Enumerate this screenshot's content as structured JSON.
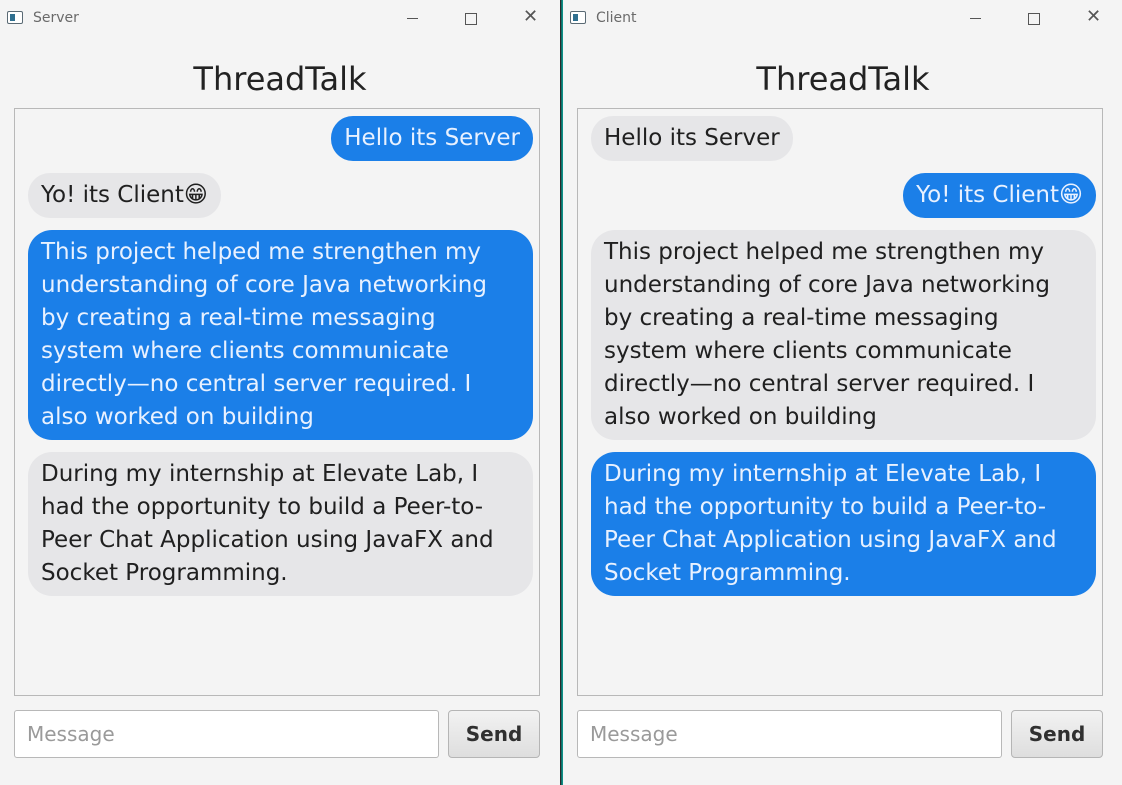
{
  "server": {
    "window_title": "Server",
    "app_heading": "ThreadTalk",
    "messages": [
      {
        "side": "right",
        "type": "sent",
        "text": "Hello its Server"
      },
      {
        "side": "left",
        "type": "recv",
        "text": "Yo! its Client😁"
      },
      {
        "side": "left",
        "type": "sent",
        "text": "This project helped me strengthen my understanding of core Java networking by creating a real-time messaging system where clients communicate directly—no central server required. I also worked on building"
      },
      {
        "side": "left",
        "type": "recv",
        "text": "During my internship at Elevate Lab, I had the opportunity to build a Peer-to-Peer Chat Application using JavaFX and Socket Programming."
      }
    ],
    "input_placeholder": "Message",
    "send_label": "Send"
  },
  "client": {
    "window_title": "Client",
    "app_heading": "ThreadTalk",
    "messages": [
      {
        "side": "left",
        "type": "recv",
        "text": "Hello its Server"
      },
      {
        "side": "right",
        "type": "sent",
        "text": "Yo! its Client😁"
      },
      {
        "side": "left",
        "type": "recv",
        "text": "This project helped me strengthen my understanding of core Java networking by creating a real-time messaging system where clients communicate directly—no central server required. I also worked on building"
      },
      {
        "side": "left",
        "type": "sent",
        "text": "During my internship at Elevate Lab, I had the opportunity to build a Peer-to-Peer Chat Application using JavaFX and Socket Programming."
      }
    ],
    "input_placeholder": "Message",
    "send_label": "Send"
  },
  "colors": {
    "sent_bubble": "#1b7fe8",
    "received_bubble": "#e6e6e8",
    "window_bg": "#f4f4f4"
  },
  "icons": {
    "window_icon": "app-window-icon",
    "minimize": "minimize-icon",
    "maximize": "maximize-icon",
    "close": "close-icon"
  }
}
